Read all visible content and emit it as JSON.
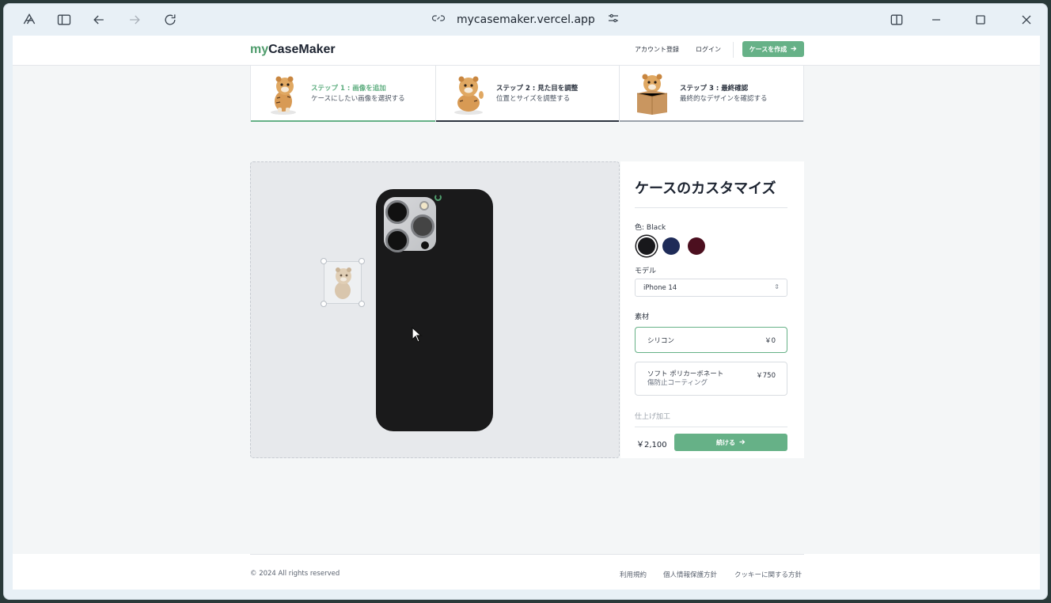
{
  "browser": {
    "url": "mycasemaker.vercel.app"
  },
  "nav": {
    "logo_my": "my",
    "logo_rest": "CaseMaker",
    "register": "アカウント登録",
    "login": "ログイン",
    "create_case": "ケースを作成"
  },
  "steps": [
    {
      "title": "ステップ 1 : 画像を追加",
      "desc": "ケースにしたい画像を選択する",
      "state": "complete"
    },
    {
      "title": "ステップ 2 : 見た目を調整",
      "desc": "位置とサイズを調整する",
      "state": "current"
    },
    {
      "title": "ステップ 3 : 最終確認",
      "desc": "最終的なデザインを確認する",
      "state": "upcoming"
    }
  ],
  "panel": {
    "title": "ケースのカスタマイズ",
    "color_label": "色: Black",
    "colors": [
      {
        "name": "Black",
        "hex": "#18181b",
        "selected": true
      },
      {
        "name": "Blue",
        "hex": "#1e2b58",
        "selected": false
      },
      {
        "name": "Rose",
        "hex": "#4c0f1f",
        "selected": false
      }
    ],
    "model_label": "モデル",
    "model_value": "iPhone 14",
    "material_label": "素材",
    "materials": [
      {
        "name": "シリコン",
        "sub": "",
        "price": "￥0",
        "selected": true
      },
      {
        "name": "ソフト ポリカーボネート",
        "sub": "傷防止コーティング",
        "price": "￥750",
        "selected": false
      }
    ],
    "finish_label": "仕上げ加工",
    "total_price": "￥2,100",
    "continue": "続ける"
  },
  "footer": {
    "copyright": "© 2024 All rights reserved",
    "terms": "利用規約",
    "privacy": "個人情報保護方針",
    "cookies": "クッキーに関する方針"
  },
  "colors": {
    "accent": "#66b187",
    "accent_text": "#5fae80"
  }
}
